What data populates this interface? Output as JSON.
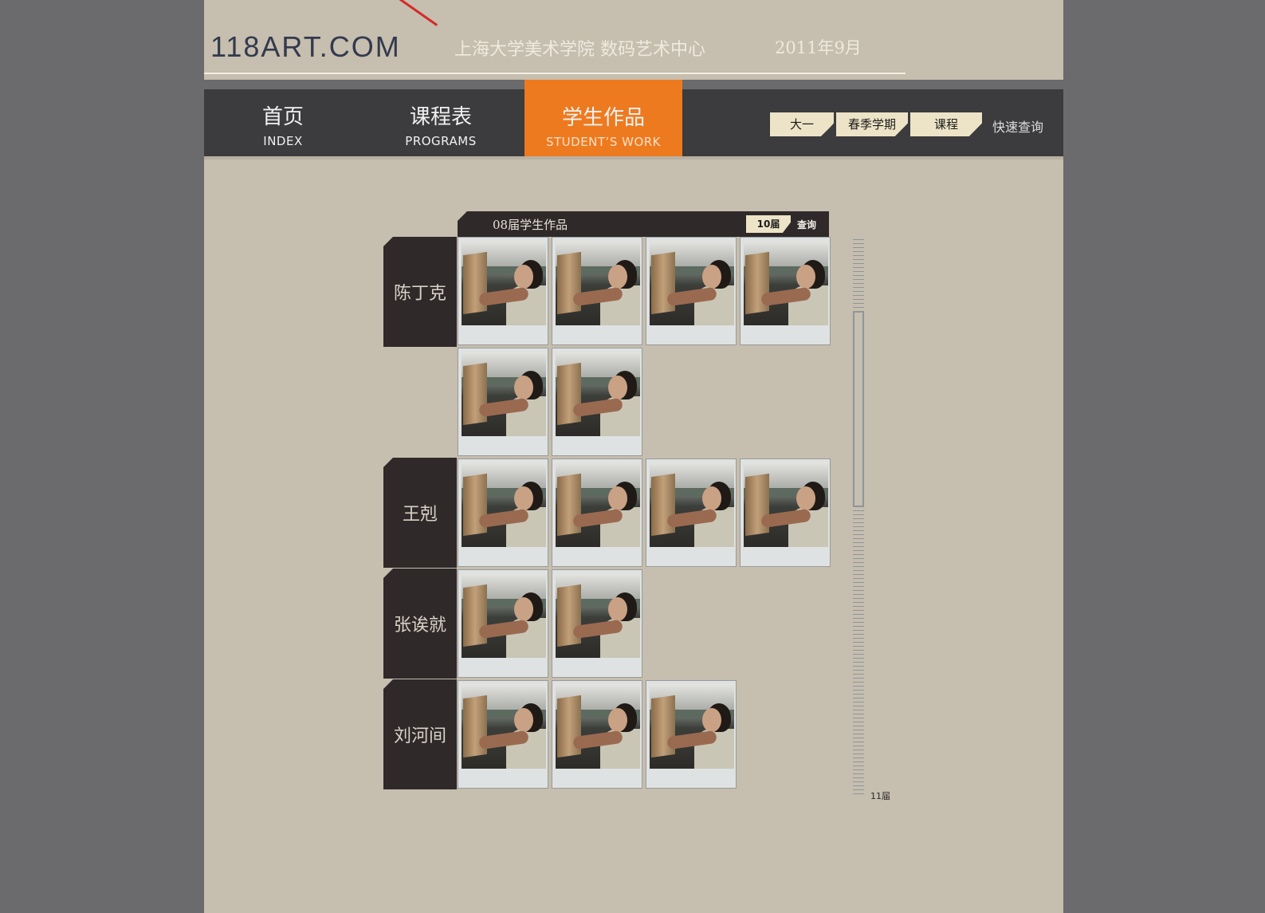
{
  "header": {
    "logo": "118ART.COM",
    "subtitle": "上海大学美术学院  数码艺术中心",
    "date": "2011年9月"
  },
  "nav": {
    "items": [
      {
        "zh": "首页",
        "en": "INDEX"
      },
      {
        "zh": "课程表",
        "en": "PROGRAMS"
      },
      {
        "zh": "学生作品",
        "en": "STUDENT’S WORK"
      }
    ],
    "active_index": 2,
    "filters": [
      "大一",
      "春季学期",
      "课程"
    ],
    "quick_search": "快速查询"
  },
  "gallery": {
    "title": "08届学生作品",
    "grade_button": "10届",
    "query_button": "查询",
    "students": [
      {
        "name": "陈丁克",
        "works": 6
      },
      {
        "name": "王剋",
        "works": 4
      },
      {
        "name": "张诶就",
        "works": 2
      },
      {
        "name": "刘河间",
        "works": 3
      }
    ]
  },
  "scroll": {
    "label": "11届"
  },
  "colors": {
    "background": "#c6beae",
    "nav_bar": "#3c3b3d",
    "active_tab": "#ee7a1f",
    "dark_panel": "#2f292a",
    "pill": "#ede3c6"
  }
}
